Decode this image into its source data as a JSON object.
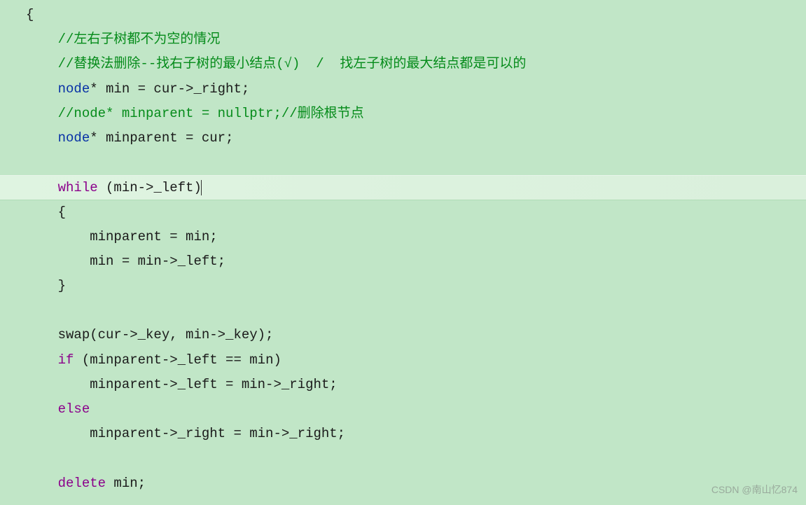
{
  "code": {
    "l1": "{",
    "l2_comment": "//左右子树都不为空的情况",
    "l3_comment": "//替换法删除--找右子树的最小结点(√)  /  找左子树的最大结点都是可以的",
    "l4_a": "node",
    "l4_b": "* min = cur->_right;",
    "l5_comment": "//node* minparent = nullptr;//删除根节点",
    "l6_a": "node",
    "l6_b": "* minparent = cur;",
    "l7": "",
    "l8_a": "while",
    "l8_b": " (min->_left)",
    "l9": "{",
    "l10": "    minparent = min;",
    "l11": "    min = min->_left;",
    "l12": "}",
    "l13": "",
    "l14": "swap(cur->_key, min->_key);",
    "l15_a": "if",
    "l15_b": " (minparent->_left == min)",
    "l16": "    minparent->_left = min->_right;",
    "l17_a": "else",
    "l18": "    minparent->_right = min->_right;",
    "l19": "",
    "l20_a": "delete",
    "l20_b": " min;",
    "l21": "}"
  },
  "watermark": "CSDN @南山忆874"
}
